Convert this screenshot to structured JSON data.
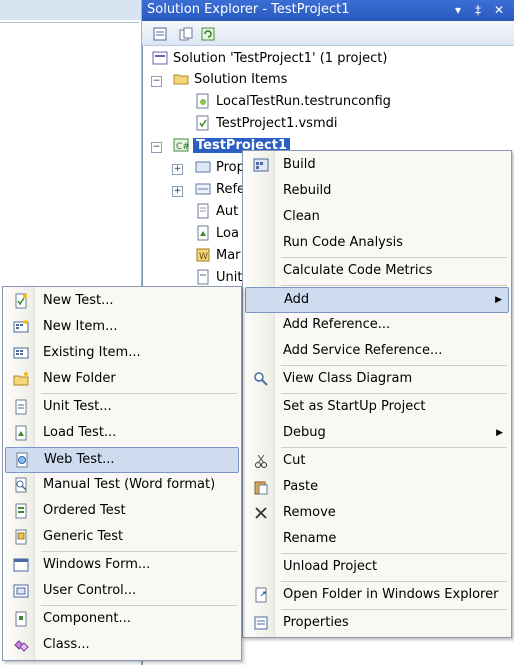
{
  "solution_explorer": {
    "title": "Solution Explorer - TestProject1",
    "title_buttons": [
      "▾",
      "‡",
      "✕"
    ],
    "toolbar": [
      "properties-icon",
      "show-all-files-icon",
      "refresh-icon"
    ],
    "tree": [
      {
        "label": "Solution 'TestProject1' (1 project)",
        "icon": "solution-icon"
      },
      {
        "label": "Solution Items",
        "icon": "folder-icon"
      },
      {
        "label": "LocalTestRun.testrunconfig",
        "icon": "config-file-icon"
      },
      {
        "label": "TestProject1.vsmdi",
        "icon": "vsmdi-file-icon"
      },
      {
        "label": "TestProject1",
        "icon": "csharp-project-icon"
      },
      {
        "label": "Prop",
        "icon": "properties-folder-icon"
      },
      {
        "label": "Refe",
        "icon": "references-icon"
      },
      {
        "label": "Aut",
        "icon": "file-icon"
      },
      {
        "label": "Loa",
        "icon": "load-test-icon"
      },
      {
        "label": "Mar",
        "icon": "manual-test-icon"
      },
      {
        "label": "Unit",
        "icon": "unit-test-icon"
      }
    ]
  },
  "project_menu": {
    "items": [
      {
        "label": "Build",
        "icon": "build-icon"
      },
      {
        "label": "Rebuild"
      },
      {
        "label": "Clean"
      },
      {
        "label": "Run Code Analysis"
      },
      {
        "label": "Calculate Code Metrics"
      },
      {
        "label": "Add",
        "submenu": true,
        "highlighted": true
      },
      {
        "label": "Add Reference..."
      },
      {
        "label": "Add Service Reference..."
      },
      {
        "label": "View Class Diagram",
        "icon": "class-diagram-icon"
      },
      {
        "label": "Set as StartUp Project"
      },
      {
        "label": "Debug",
        "submenu": true
      },
      {
        "label": "Cut",
        "icon": "cut-icon"
      },
      {
        "label": "Paste",
        "icon": "paste-icon"
      },
      {
        "label": "Remove",
        "icon": "remove-icon"
      },
      {
        "label": "Rename"
      },
      {
        "label": "Unload Project"
      },
      {
        "label": "Open Folder in Windows Explorer",
        "icon": "open-folder-icon"
      },
      {
        "label": "Properties",
        "icon": "properties-icon"
      }
    ]
  },
  "add_menu": {
    "items": [
      {
        "label": "New Test...",
        "icon": "new-test-icon"
      },
      {
        "label": "New Item...",
        "icon": "new-item-icon"
      },
      {
        "label": "Existing Item...",
        "icon": "existing-item-icon"
      },
      {
        "label": "New Folder",
        "icon": "new-folder-icon"
      },
      {
        "label": "Unit Test...",
        "icon": "unit-test-icon"
      },
      {
        "label": "Load Test...",
        "icon": "load-test-icon"
      },
      {
        "label": "Web Test...",
        "icon": "web-test-icon",
        "highlighted": true
      },
      {
        "label": "Manual Test (Word format)",
        "icon": "manual-test-icon"
      },
      {
        "label": "Ordered Test",
        "icon": "ordered-test-icon"
      },
      {
        "label": "Generic Test",
        "icon": "generic-test-icon"
      },
      {
        "label": "Windows Form...",
        "icon": "windows-form-icon"
      },
      {
        "label": "User Control...",
        "icon": "user-control-icon"
      },
      {
        "label": "Component...",
        "icon": "component-icon"
      },
      {
        "label": "Class...",
        "icon": "class-icon"
      }
    ]
  },
  "colors": {
    "titlebar": "#2a59be",
    "selection": "#2c5fc3",
    "menu_highlight": "#cfdcf0",
    "menu_bg": "#f9f8f4"
  }
}
